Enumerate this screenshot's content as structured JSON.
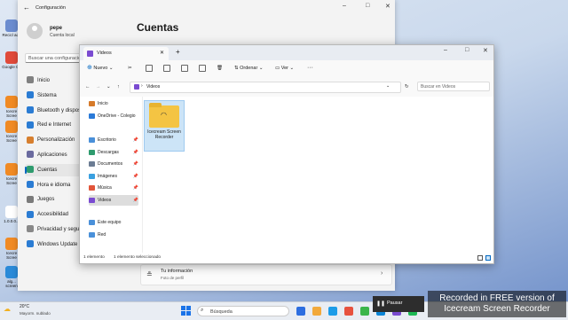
{
  "desktop": {
    "icons": [
      {
        "label": "Recicl ado",
        "color": "#6b8ccf"
      },
      {
        "label": "Google Ch",
        "color": "#e04a3a"
      },
      {
        "label": "Icecre Scree",
        "color": "#f08a24"
      },
      {
        "label": "Icecre Scree",
        "color": "#f08a24"
      },
      {
        "label": "Icecre Scree",
        "color": "#f08a24"
      },
      {
        "label": "1.0.0.0...",
        "color": "#ffffff"
      },
      {
        "label": "Icecre Scree",
        "color": "#f08a24"
      },
      {
        "label": "alg... screen",
        "color": "#2a8ad8"
      }
    ]
  },
  "settings": {
    "title": "Configuración",
    "user_name": "pepe",
    "user_account": "Cuenta local",
    "search_placeholder": "Buscar una configuración",
    "page_title": "Cuentas",
    "nav": [
      {
        "label": "Inicio",
        "color": "#808080"
      },
      {
        "label": "Sistema",
        "color": "#2b7cd3"
      },
      {
        "label": "Bluetooth y dispositivos",
        "color": "#2b7cd3"
      },
      {
        "label": "Red e Internet",
        "color": "#2b7cd3"
      },
      {
        "label": "Personalización",
        "color": "#d77f2e"
      },
      {
        "label": "Aplicaciones",
        "color": "#6b6b9f"
      },
      {
        "label": "Cuentas",
        "color": "#2e9b6e"
      },
      {
        "label": "Hora e idioma",
        "color": "#2b7cd3"
      },
      {
        "label": "Juegos",
        "color": "#7a7a7a"
      },
      {
        "label": "Accesibilidad",
        "color": "#2b7cd3"
      },
      {
        "label": "Privacidad y seguridad",
        "color": "#888888"
      },
      {
        "label": "Windows Update",
        "color": "#2b7cd3"
      }
    ],
    "selected_nav": "Cuentas",
    "info_card": {
      "title": "Tu información",
      "subtitle": "Foto de perfil"
    }
  },
  "explorer": {
    "tab_title": "Videos",
    "toolbar": {
      "new_label": "Nuevo",
      "sort_label": "Ordenar",
      "view_label": "Ver"
    },
    "address": "Videos",
    "search_placeholder": "Buscar en Videos",
    "sidebar": [
      {
        "label": "Inicio",
        "color": "#d67a2a",
        "pinned": false
      },
      {
        "label": "OneDrive - Colegio",
        "color": "#2a7ad8",
        "pinned": false
      },
      {
        "label": "Escritorio",
        "color": "#4a90d9",
        "pinned": true
      },
      {
        "label": "Descargas",
        "color": "#2e9b6e",
        "pinned": true
      },
      {
        "label": "Documentos",
        "color": "#6b7c93",
        "pinned": true
      },
      {
        "label": "Imágenes",
        "color": "#3aa0e0",
        "pinned": true
      },
      {
        "label": "Música",
        "color": "#e2553a",
        "pinned": true
      },
      {
        "label": "Videos",
        "color": "#7a4bd1",
        "pinned": true
      },
      {
        "label": "Este equipo",
        "color": "#4a90d9",
        "pinned": false
      },
      {
        "label": "Red",
        "color": "#4a90d9",
        "pinned": false
      }
    ],
    "folder_name": "Icecream Screen Recorder",
    "status_count": "1 elemento",
    "status_selected": "1 elemento seleccionado"
  },
  "taskbar": {
    "weather_temp": "20°C",
    "weather_desc": "Mayorm. nublado",
    "search_placeholder": "Búsqueda",
    "apps": [
      "#2d6ee0",
      "#f2a93b",
      "#1c9ce8",
      "#e7523f",
      "#3bb54a",
      "#0a84d6",
      "#7a4bd1",
      "#1db954"
    ]
  },
  "recorder": {
    "pause_label": "Pausar",
    "watermark": "Recorded in FREE version of Icecream Screen Recorder"
  }
}
